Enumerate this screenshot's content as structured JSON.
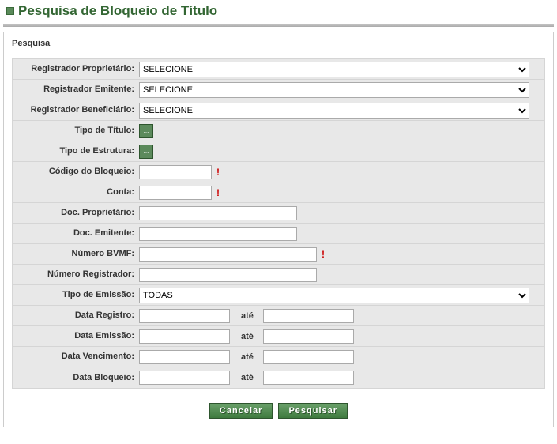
{
  "page": {
    "title": "Pesquisa de Bloqueio de Título"
  },
  "panel": {
    "title": "Pesquisa"
  },
  "form": {
    "labels": {
      "registrador_proprietario": "Registrador Proprietário:",
      "registrador_emitente": "Registrador Emitente:",
      "registrador_beneficiario": "Registrador Beneficiário:",
      "tipo_titulo": "Tipo de Título:",
      "tipo_estrutura": "Tipo de Estrutura:",
      "codigo_bloqueio": "Código do Bloqueio:",
      "conta": "Conta:",
      "doc_proprietario": "Doc. Proprietário:",
      "doc_emitente": "Doc. Emitente:",
      "numero_bvmf": "Número BVMF:",
      "numero_registrador": "Número Registrador:",
      "tipo_emissao": "Tipo de Emissão:",
      "data_registro": "Data Registro:",
      "data_emissao": "Data Emissão:",
      "data_vencimento": "Data Vencimento:",
      "data_bloqueio": "Data Bloqueio:"
    },
    "selects": {
      "registrador_proprietario": {
        "value": "SELECIONE"
      },
      "registrador_emitente": {
        "value": "SELECIONE"
      },
      "registrador_beneficiario": {
        "value": "SELECIONE"
      },
      "tipo_emissao": {
        "value": "TODAS"
      }
    },
    "inputs": {
      "codigo_bloqueio": "",
      "conta": "",
      "doc_proprietario": "",
      "doc_emitente": "",
      "numero_bvmf": "",
      "numero_registrador": "",
      "data_registro_de": "",
      "data_registro_ate": "",
      "data_emissao_de": "",
      "data_emissao_ate": "",
      "data_vencimento_de": "",
      "data_vencimento_ate": "",
      "data_bloqueio_de": "",
      "data_bloqueio_ate": ""
    },
    "ate_label": "até",
    "required_marker": "!",
    "ellipsis_label": "..."
  },
  "buttons": {
    "cancel": "Cancelar",
    "search": "Pesquisar"
  }
}
